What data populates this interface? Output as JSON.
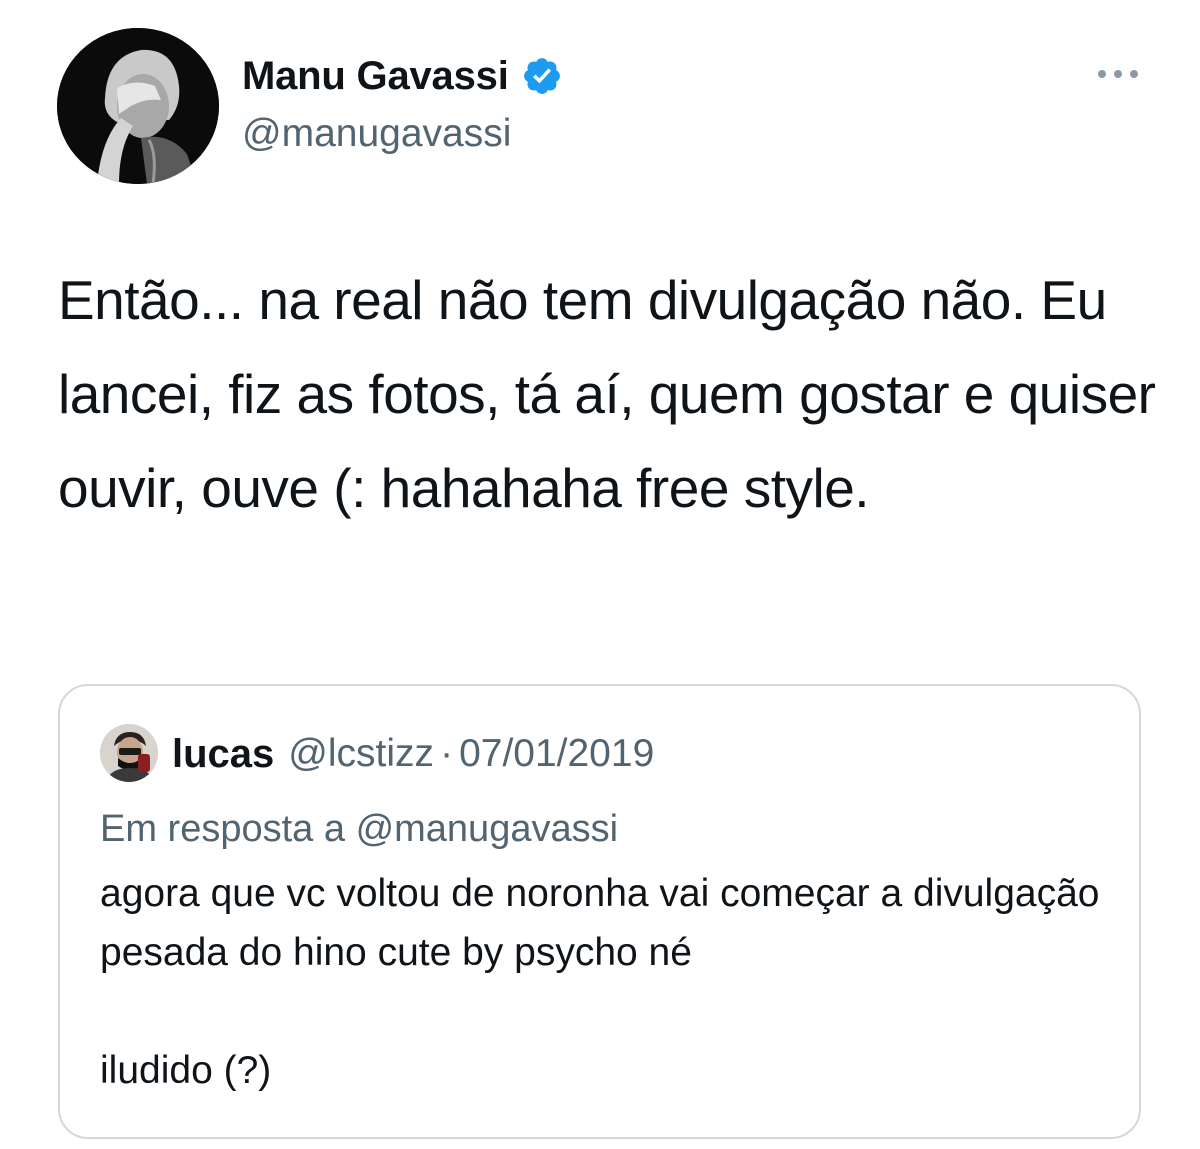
{
  "tweet": {
    "author": {
      "name": "Manu Gavassi",
      "handle": "@manugavassi",
      "verified": true,
      "avatar_icon": "profile-photo"
    },
    "more_icon": "more-horizontal-icon",
    "text": "Então... na real não tem divulgação não. Eu lancei, fiz as fotos, tá aí, quem gostar e quiser ouvir, ouve (: hahahaha free style.",
    "quoted": {
      "name": "lucas",
      "handle": "@lcstizz",
      "separator": "·",
      "date": "07/01/2019",
      "reply_prefix": "Em resposta a ",
      "reply_handle": "@manugavassi",
      "text": "agora que vc voltou de noronha vai começar a divulgação pesada do hino cute by psycho né\n\niludido (?)"
    }
  },
  "colors": {
    "primary_text": "#0f1419",
    "secondary_text": "#536471",
    "verified_blue": "#1d9bf0",
    "border": "#cfd9de"
  }
}
